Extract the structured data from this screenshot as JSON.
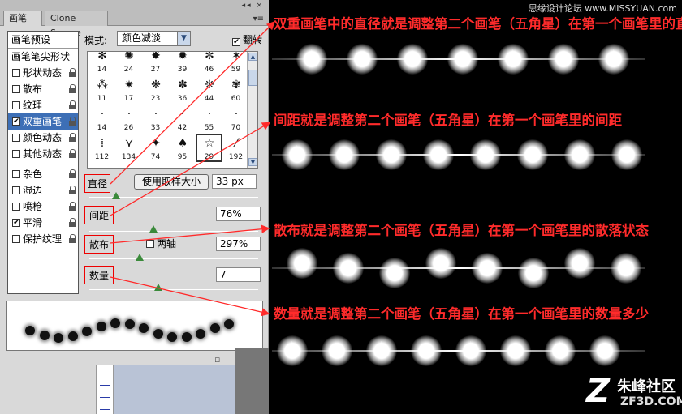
{
  "panel": {
    "tab_active": "画笔",
    "tab_inactive": "Clone Source",
    "close_glyph": "×",
    "menu_glyph": "▾≡",
    "win_buttons": "◂◂ ×",
    "list_header": "画笔预设",
    "brush_tip": "画笔笔尖形状",
    "items": [
      {
        "label": "形状动态",
        "checked": false,
        "selected": false
      },
      {
        "label": "散布",
        "checked": false,
        "selected": false
      },
      {
        "label": "纹理",
        "checked": false,
        "selected": false
      },
      {
        "label": "双重画笔",
        "checked": true,
        "selected": true
      },
      {
        "label": "颜色动态",
        "checked": false,
        "selected": false
      },
      {
        "label": "其他动态",
        "checked": false,
        "selected": false
      },
      {
        "label": "杂色",
        "checked": false,
        "selected": false
      },
      {
        "label": "湿边",
        "checked": false,
        "selected": false
      },
      {
        "label": "喷枪",
        "checked": false,
        "selected": false
      },
      {
        "label": "平滑",
        "checked": true,
        "selected": false
      },
      {
        "label": "保护纹理",
        "checked": false,
        "selected": false
      }
    ],
    "mode_label": "模式:",
    "mode_value": "颜色减淡",
    "flip_label": "翻转",
    "flip_checked": true,
    "brushes": [
      {
        "glyph": "✻",
        "size": "14"
      },
      {
        "glyph": "✺",
        "size": "24"
      },
      {
        "glyph": "✸",
        "size": "27"
      },
      {
        "glyph": "✹",
        "size": "39"
      },
      {
        "glyph": "✼",
        "size": "46"
      },
      {
        "glyph": "✶",
        "size": "59"
      },
      {
        "glyph": "⁂",
        "size": "11"
      },
      {
        "glyph": "✷",
        "size": "17"
      },
      {
        "glyph": "❋",
        "size": "23"
      },
      {
        "glyph": "✽",
        "size": "36"
      },
      {
        "glyph": "❊",
        "size": "44"
      },
      {
        "glyph": "✾",
        "size": "60"
      },
      {
        "glyph": "·",
        "size": "14"
      },
      {
        "glyph": "·",
        "size": "26"
      },
      {
        "glyph": "·",
        "size": "33"
      },
      {
        "glyph": "·",
        "size": "42"
      },
      {
        "glyph": "·",
        "size": "55"
      },
      {
        "glyph": "·",
        "size": "70"
      },
      {
        "glyph": "⁞",
        "size": "112"
      },
      {
        "glyph": "⋎",
        "size": "134"
      },
      {
        "glyph": "✦",
        "size": "74"
      },
      {
        "glyph": "♠",
        "size": "95"
      },
      {
        "glyph": "☆",
        "size": "29"
      },
      {
        "glyph": "⁄",
        "size": "192"
      }
    ],
    "selected_brush": 22,
    "diameter_label": "直径",
    "use_sample_label": "使用取样大小",
    "diameter_value": "33 px",
    "spacing_label": "间距",
    "spacing_value": "76%",
    "scatter_label": "散布",
    "both_axes_label": "两轴",
    "both_axes_checked": false,
    "scatter_value": "297%",
    "count_label": "数量",
    "count_value": "7",
    "diameter_slider": 0.16,
    "spacing_slider": 0.38,
    "scatter_slider": 0.3,
    "count_slider": 0.41,
    "bottom_icons": "▫ ◫ 🗑"
  },
  "annotations": {
    "site": "思缘设计论坛 www.MISSYUAN.com",
    "a1": "双重画笔中的直径就是调整第二个画笔（五角星）在第一个画笔里的直径大小",
    "a2": "间距就是调整第二个画笔（五角星）在第一个画笔里的间距",
    "a3": "散布就是调整第二个画笔（五角星）在第一个画笔里的散落状态",
    "a4": "数量就是调整第二个画笔（五角星）在第一个画笔里的数量多少"
  },
  "logo": {
    "mark": "Z",
    "name": "朱峰社区",
    "domain": "ZF3D.COM"
  },
  "colors": {
    "annotation": "#ff2b2b",
    "selection": "#3d6fb6",
    "slider_thumb": "#3a8a3a"
  }
}
